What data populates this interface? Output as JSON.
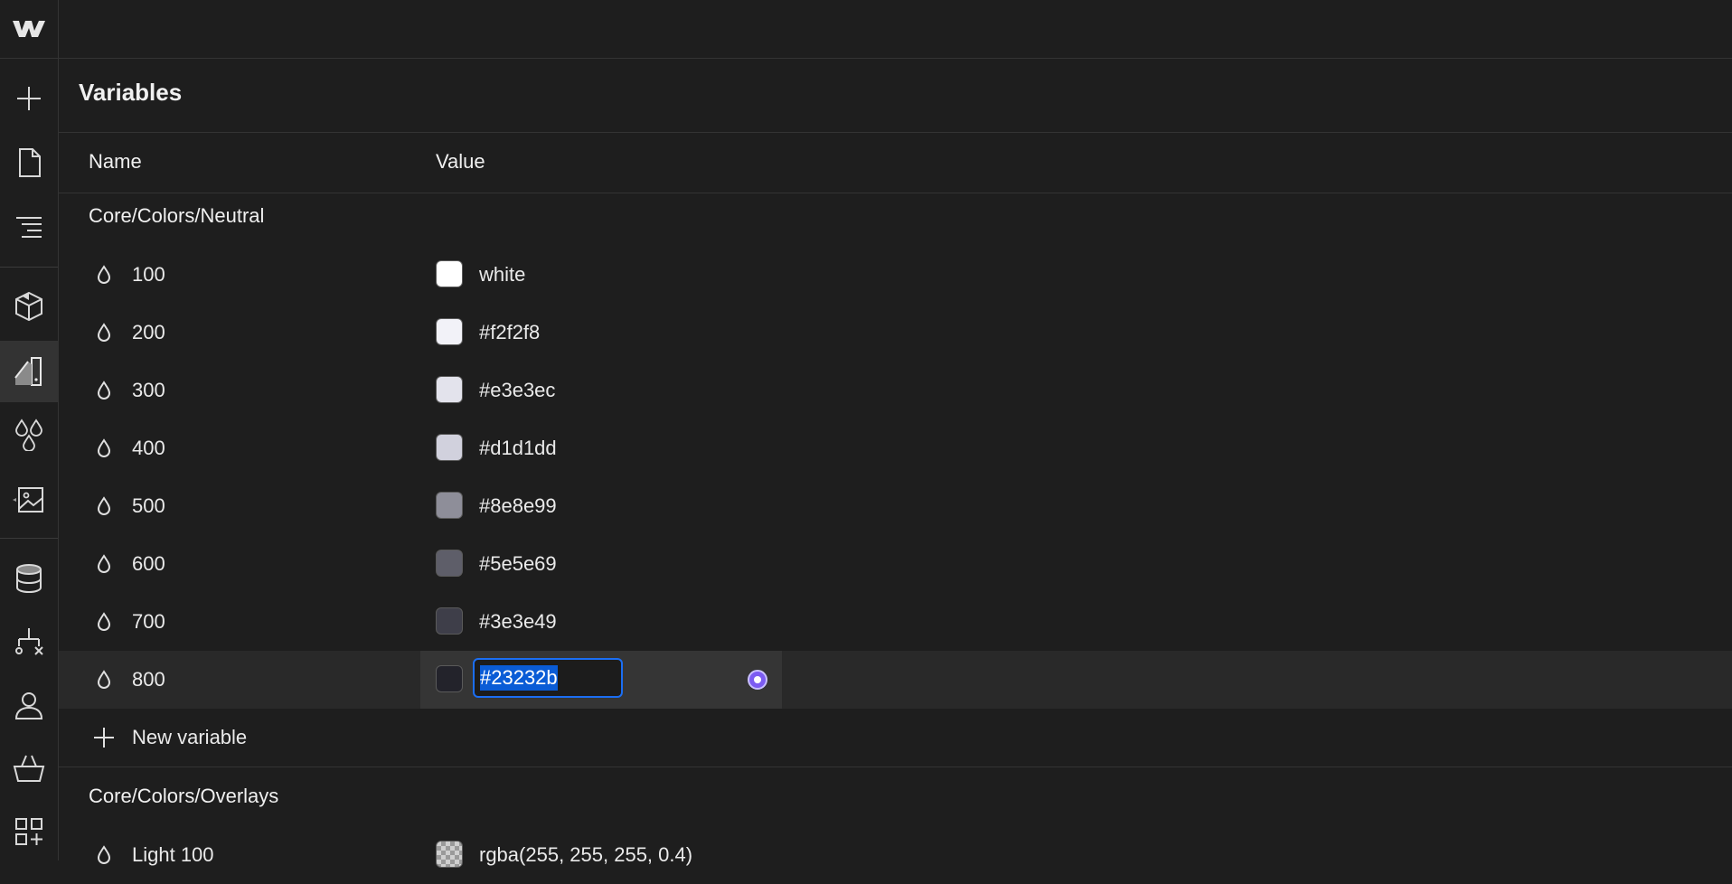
{
  "sidebar": {
    "logo_icon": "webflow-logo-icon",
    "items": [
      {
        "icon": "add-icon",
        "active": false
      },
      {
        "icon": "page-icon",
        "active": false
      },
      {
        "icon": "navigator-icon",
        "active": false
      },
      {
        "icon": "components-icon",
        "active": false
      },
      {
        "icon": "style-selectors-icon",
        "active": true
      },
      {
        "icon": "variables-icon",
        "active": false
      },
      {
        "icon": "assets-icon",
        "active": false
      },
      {
        "icon": "cms-icon",
        "active": false
      },
      {
        "icon": "logic-icon",
        "active": false
      },
      {
        "icon": "users-icon",
        "active": false
      },
      {
        "icon": "ecommerce-icon",
        "active": false
      },
      {
        "icon": "apps-icon",
        "active": false
      }
    ]
  },
  "panel": {
    "title": "Variables",
    "columns": {
      "name": "Name",
      "value": "Value"
    },
    "groups": [
      {
        "title": "Core/Colors/Neutral",
        "variables": [
          {
            "name": "100",
            "value": "white",
            "color": "#ffffff"
          },
          {
            "name": "200",
            "value": "#f2f2f8",
            "color": "#f2f2f8"
          },
          {
            "name": "300",
            "value": "#e3e3ec",
            "color": "#e3e3ec"
          },
          {
            "name": "400",
            "value": "#d1d1dd",
            "color": "#d1d1dd"
          },
          {
            "name": "500",
            "value": "#8e8e99",
            "color": "#8e8e99"
          },
          {
            "name": "600",
            "value": "#5e5e69",
            "color": "#5e5e69"
          },
          {
            "name": "700",
            "value": "#3e3e49",
            "color": "#3e3e49"
          },
          {
            "name": "800",
            "value": "#23232b",
            "color": "#23232b",
            "editing": true
          }
        ],
        "new_variable_label": "New variable"
      },
      {
        "title": "Core/Colors/Overlays",
        "variables": [
          {
            "name": "Light 100",
            "value": "rgba(255, 255, 255, 0.4)",
            "color": "rgba(255,255,255,0.4)"
          }
        ]
      }
    ]
  },
  "colors": {
    "accent": "#1b6ef3",
    "selection": "#0a5cd6",
    "picker": "#7c5cf2"
  }
}
